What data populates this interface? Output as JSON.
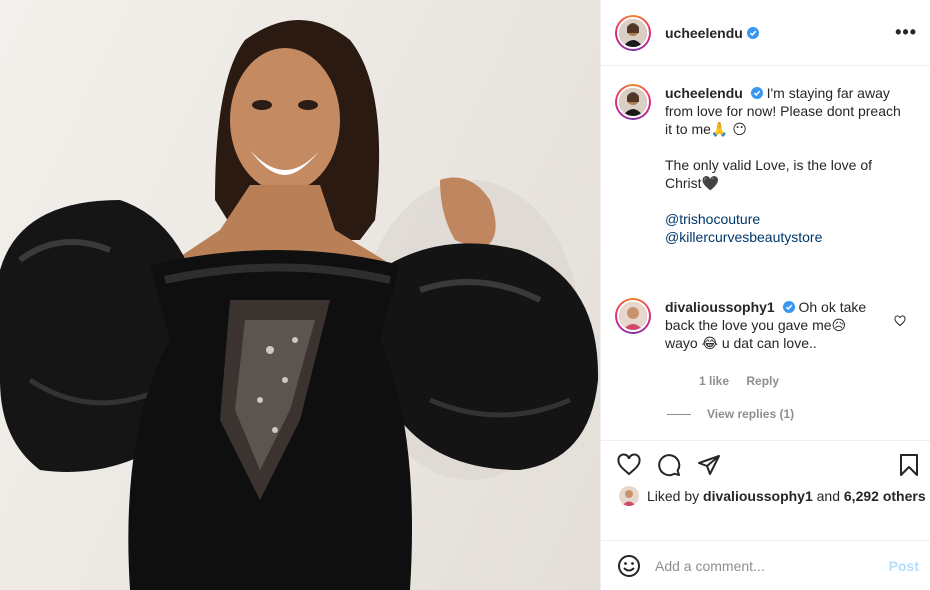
{
  "post": {
    "photo": {
      "alt_icon": "post-photo"
    },
    "header": {
      "username": "ucheelendu",
      "more": "•••"
    },
    "caption": {
      "username": "ucheelendu",
      "line1": "I'm staying far away from love for now! Please dont preach it to me🙏 😶",
      "line2": "The only valid Love, is the love of Christ🖤",
      "mention1": "@trishocouture",
      "mention2": "@killercurvesbeautystore"
    },
    "comment": {
      "username": "divalioussophy1",
      "text": "Oh ok take back the love you gave me😥 wayo 😂 u dat can love..",
      "likes": "1 like",
      "reply": "Reply",
      "view_replies": "View replies (1)"
    },
    "likes": {
      "prefix": "Liked by",
      "user": "divalioussophy1",
      "suffix": "and",
      "others": "6,292 others"
    },
    "add_comment": {
      "placeholder": "Add a comment...",
      "post": "Post"
    }
  },
  "colors": {
    "verified": "#3897f0",
    "mention": "#00376b",
    "muted": "#8e8e8e",
    "post_disabled": "#b2dffc"
  },
  "icons": [
    "heart-icon",
    "comment-icon",
    "share-icon",
    "bookmark-icon",
    "emoji-icon",
    "verified-icon",
    "more-icon"
  ]
}
